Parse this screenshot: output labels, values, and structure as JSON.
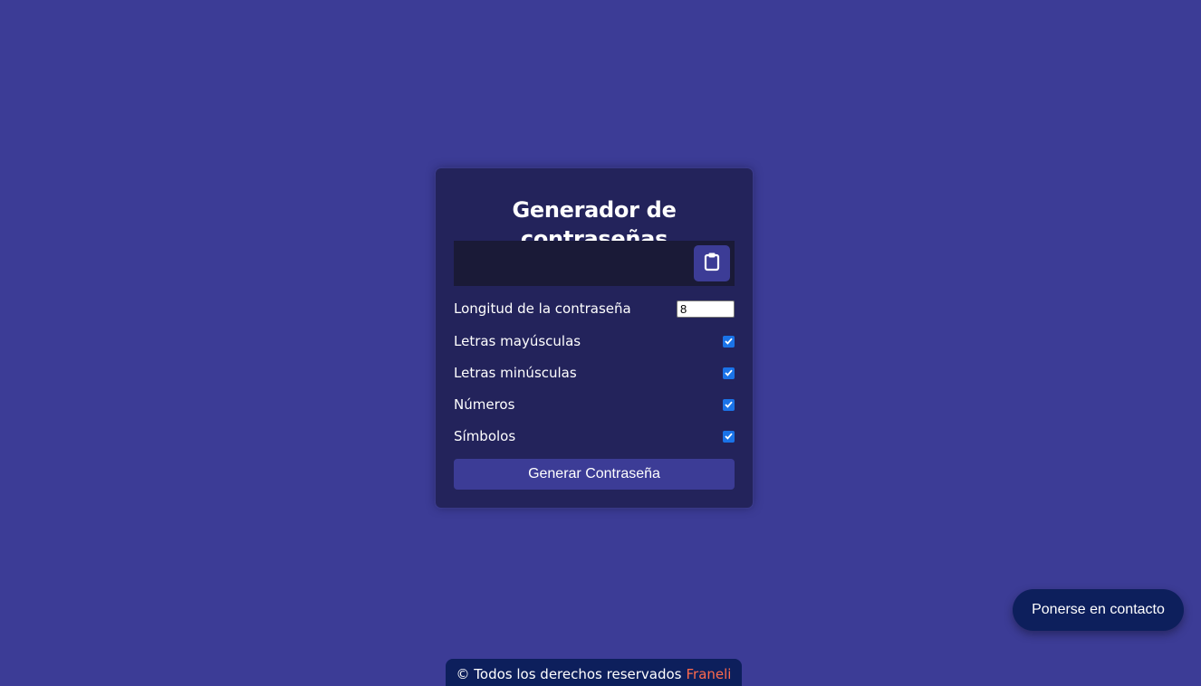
{
  "card": {
    "title": "Generador de contraseñas",
    "password_result": "",
    "copy_icon": "clipboard-icon",
    "length_label": "Longitud de la contraseña",
    "length_value": "8",
    "options": [
      {
        "label": "Letras mayúsculas",
        "checked": true
      },
      {
        "label": "Letras minúsculas",
        "checked": true
      },
      {
        "label": "Números",
        "checked": true
      },
      {
        "label": "Símbolos",
        "checked": true
      }
    ],
    "generate_label": "Generar Contraseña"
  },
  "contact": {
    "label": "Ponerse en contacto"
  },
  "footer": {
    "text": "© Todos los derechos reservados",
    "brand": "Franeli"
  },
  "colors": {
    "background": "#3c3c96",
    "card": "#23235b",
    "result_box": "#1a1a37",
    "button": "#3c3c96",
    "contact_button": "#0d1f5c",
    "brand_accent": "#ff6a4d",
    "checkbox": "#1a73e8"
  }
}
